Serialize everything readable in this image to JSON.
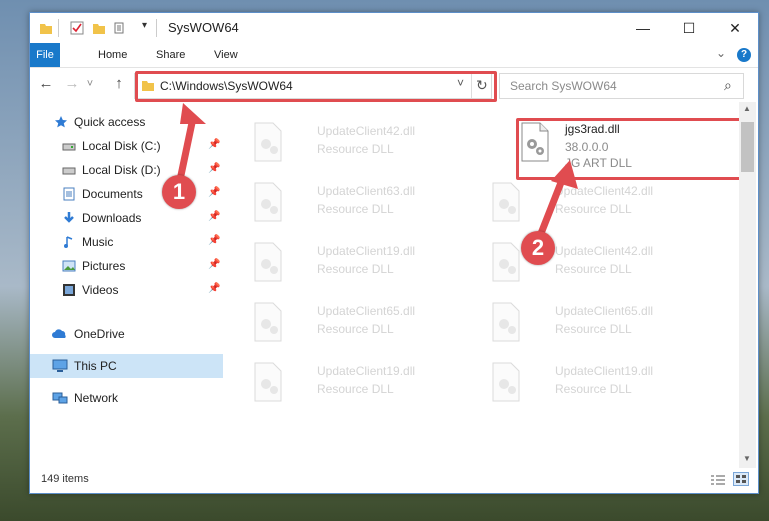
{
  "window": {
    "title": "SysWOW64",
    "controls": {
      "minimize": "—",
      "maximize": "☐",
      "close": "✕"
    }
  },
  "ribbon": {
    "tabs": [
      "File",
      "Home",
      "Share",
      "View"
    ],
    "help": "?",
    "chevron": "⌄"
  },
  "nav": {
    "back": "←",
    "forward": "→",
    "recent": "˅",
    "up": "↑",
    "address": "C:\\Windows\\SysWOW64",
    "dropdown": "˅",
    "refresh": "↻",
    "search_placeholder": "Search SysWOW64",
    "search_icon": "⌕"
  },
  "sidebar": {
    "items": [
      {
        "label": "Quick access",
        "icon": "star-icon",
        "pinned": false
      },
      {
        "label": "Local Disk (C:)",
        "icon": "drive-icon",
        "pinned": true
      },
      {
        "label": "Local Disk (D:)",
        "icon": "drive-icon",
        "pinned": true
      },
      {
        "label": "Documents",
        "icon": "documents-icon",
        "pinned": true
      },
      {
        "label": "Downloads",
        "icon": "downloads-icon",
        "pinned": true
      },
      {
        "label": "Music",
        "icon": "music-icon",
        "pinned": true
      },
      {
        "label": "Pictures",
        "icon": "pictures-icon",
        "pinned": true
      },
      {
        "label": "Videos",
        "icon": "videos-icon",
        "pinned": true
      },
      {
        "label": "OneDrive",
        "icon": "cloud-icon",
        "pinned": false
      },
      {
        "label": "This PC",
        "icon": "computer-icon",
        "pinned": false,
        "selected": true
      },
      {
        "label": "Network",
        "icon": "network-icon",
        "pinned": false
      }
    ]
  },
  "files": {
    "left": [
      {
        "name": "UpdateClient42.dll",
        "type": "Resource DLL"
      },
      {
        "name": "UpdateClient63.dll",
        "type": "Resource DLL"
      },
      {
        "name": "UpdateClient19.dll",
        "type": "Resource DLL"
      },
      {
        "name": "UpdateClient65.dll",
        "type": "Resource DLL"
      },
      {
        "name": "UpdateClient19.dll",
        "type": "Resource DLL"
      }
    ],
    "right": [
      {
        "name": "jgs3rad.dll",
        "type": "38.0.0.0",
        "desc": "JG ART DLL",
        "highlighted": true
      },
      {
        "name": "UpdateClient42.dll",
        "type": "Resource DLL"
      },
      {
        "name": "UpdateClient42.dll",
        "type": "Resource DLL"
      },
      {
        "name": "UpdateClient65.dll",
        "type": "Resource DLL"
      },
      {
        "name": "UpdateClient19.dll",
        "type": "Resource DLL"
      }
    ]
  },
  "status": {
    "count": "149 items"
  },
  "annotations": {
    "step1": "1",
    "step2": "2"
  },
  "colors": {
    "accent": "#1979ca",
    "highlight": "#e04c50",
    "selection": "#cce4f7"
  }
}
